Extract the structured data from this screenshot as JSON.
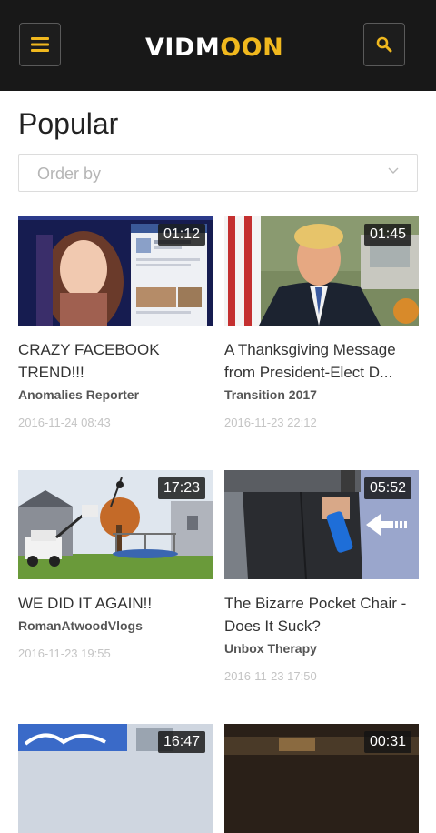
{
  "header": {
    "logo_part1": "VIDM",
    "logo_part2": "OO",
    "logo_part3": "N",
    "menu_icon": "hamburger-menu-icon",
    "search_icon": "search-icon",
    "accent_color": "#f0b81e",
    "background_color": "#181818"
  },
  "page": {
    "title": "Popular",
    "order_placeholder": "Order by"
  },
  "videos": [
    {
      "title": "CRAZY FACEBOOK TREND!!!",
      "channel": "Anomalies Reporter",
      "date": "2016-11-24 08:43",
      "duration": "01:12"
    },
    {
      "title": "A Thanksgiving Message from President-Elect D...",
      "channel": "Transition 2017",
      "date": "2016-11-23 22:12",
      "duration": "01:45"
    },
    {
      "title": "WE DID IT AGAIN!!",
      "channel": "RomanAtwoodVlogs",
      "date": "2016-11-23 19:55",
      "duration": "17:23"
    },
    {
      "title": "The Bizarre Pocket Chair - Does It Suck?",
      "channel": "Unbox Therapy",
      "date": "2016-11-23 17:50",
      "duration": "05:52"
    },
    {
      "title": "",
      "channel": "",
      "date": "",
      "duration": "16:47"
    },
    {
      "title": "",
      "channel": "",
      "date": "",
      "duration": "00:31"
    }
  ]
}
